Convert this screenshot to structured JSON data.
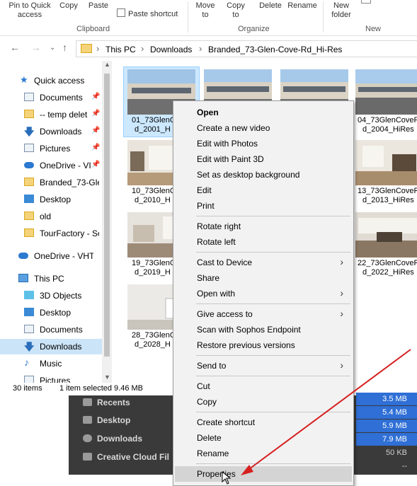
{
  "ribbon": {
    "pin_quick_access": "Pin to Quick access",
    "copy": "Copy",
    "paste": "Paste",
    "paste_shortcut": "Paste shortcut",
    "move_to": "Move to",
    "copy_to": "Copy to",
    "delete": "Delete",
    "rename": "Rename",
    "new_folder": "New folder",
    "groups": {
      "clipboard": "Clipboard",
      "organize": "Organize",
      "new": "New"
    }
  },
  "address": {
    "crumbs": [
      "This PC",
      "Downloads",
      "Branded_73-Glen-Cove-Rd_Hi-Res"
    ]
  },
  "nav": {
    "items": [
      {
        "label": "Quick access",
        "icon": "star-icon"
      },
      {
        "label": "Documents",
        "icon": "documents-icon",
        "pinned": true
      },
      {
        "label": "-- temp delet",
        "icon": "folder-icon",
        "pinned": true
      },
      {
        "label": "Downloads",
        "icon": "download-icon",
        "pinned": true
      },
      {
        "label": "Pictures",
        "icon": "pictures-icon",
        "pinned": true
      },
      {
        "label": "OneDrive - VI",
        "icon": "onedrive-icon",
        "pinned": true
      },
      {
        "label": "Branded_73-Glen",
        "icon": "folder-icon"
      },
      {
        "label": "Desktop",
        "icon": "desktop-icon"
      },
      {
        "label": "old",
        "icon": "folder-icon"
      },
      {
        "label": "TourFactory - So",
        "icon": "folder-icon"
      },
      {
        "label": "OneDrive - VHT",
        "icon": "onedrive-icon"
      },
      {
        "label": "This PC",
        "icon": "computer-icon"
      },
      {
        "label": "3D Objects",
        "icon": "3d-objects-icon"
      },
      {
        "label": "Desktop",
        "icon": "desktop-icon"
      },
      {
        "label": "Documents",
        "icon": "documents-icon"
      },
      {
        "label": "Downloads",
        "icon": "download-icon",
        "selected": true
      },
      {
        "label": "Music",
        "icon": "music-icon"
      },
      {
        "label": "Pictures",
        "icon": "pictures-icon"
      }
    ]
  },
  "files": {
    "row1": [
      "01_73GlenC",
      "d_2001_H",
      "04_73GlenCoveR",
      "d_2004_HiRes"
    ],
    "row2": [
      "10_73GlenC",
      "d_2010_H",
      "13_73GlenCoveR",
      "d_2013_HiRes"
    ],
    "row3": [
      "19_73GlenC",
      "d_2019_H",
      "22_73GlenCoveR",
      "d_2022_HiRes"
    ],
    "row4": [
      "28_73GlenC",
      "d_2028_H"
    ]
  },
  "status": {
    "count": "30 items",
    "selection": "1 item selected 9.46 MB"
  },
  "mac_window": {
    "items": [
      "Recents",
      "Desktop",
      "Downloads",
      "Creative Cloud Fil"
    ],
    "sizes": [
      "3.5 MB",
      "5.4 MB",
      "5.9 MB",
      "7.9 MB",
      "50 KB",
      "--"
    ]
  },
  "context_menu": {
    "open": "Open",
    "create_video": "Create a new video",
    "edit_photos": "Edit with Photos",
    "edit_paint3d": "Edit with Paint 3D",
    "set_bg": "Set as desktop background",
    "edit": "Edit",
    "print": "Print",
    "rotate_right": "Rotate right",
    "rotate_left": "Rotate left",
    "cast": "Cast to Device",
    "share": "Share",
    "open_with": "Open with",
    "give_access": "Give access to",
    "scan": "Scan with Sophos Endpoint",
    "restore": "Restore previous versions",
    "send_to": "Send to",
    "cut": "Cut",
    "copy": "Copy",
    "create_shortcut": "Create shortcut",
    "delete": "Delete",
    "rename": "Rename",
    "properties": "Properties"
  },
  "colors": {
    "selection": "#cce4f7",
    "annotation_arrow": "#d62020",
    "mac_highlight": "#2f6fd6"
  }
}
